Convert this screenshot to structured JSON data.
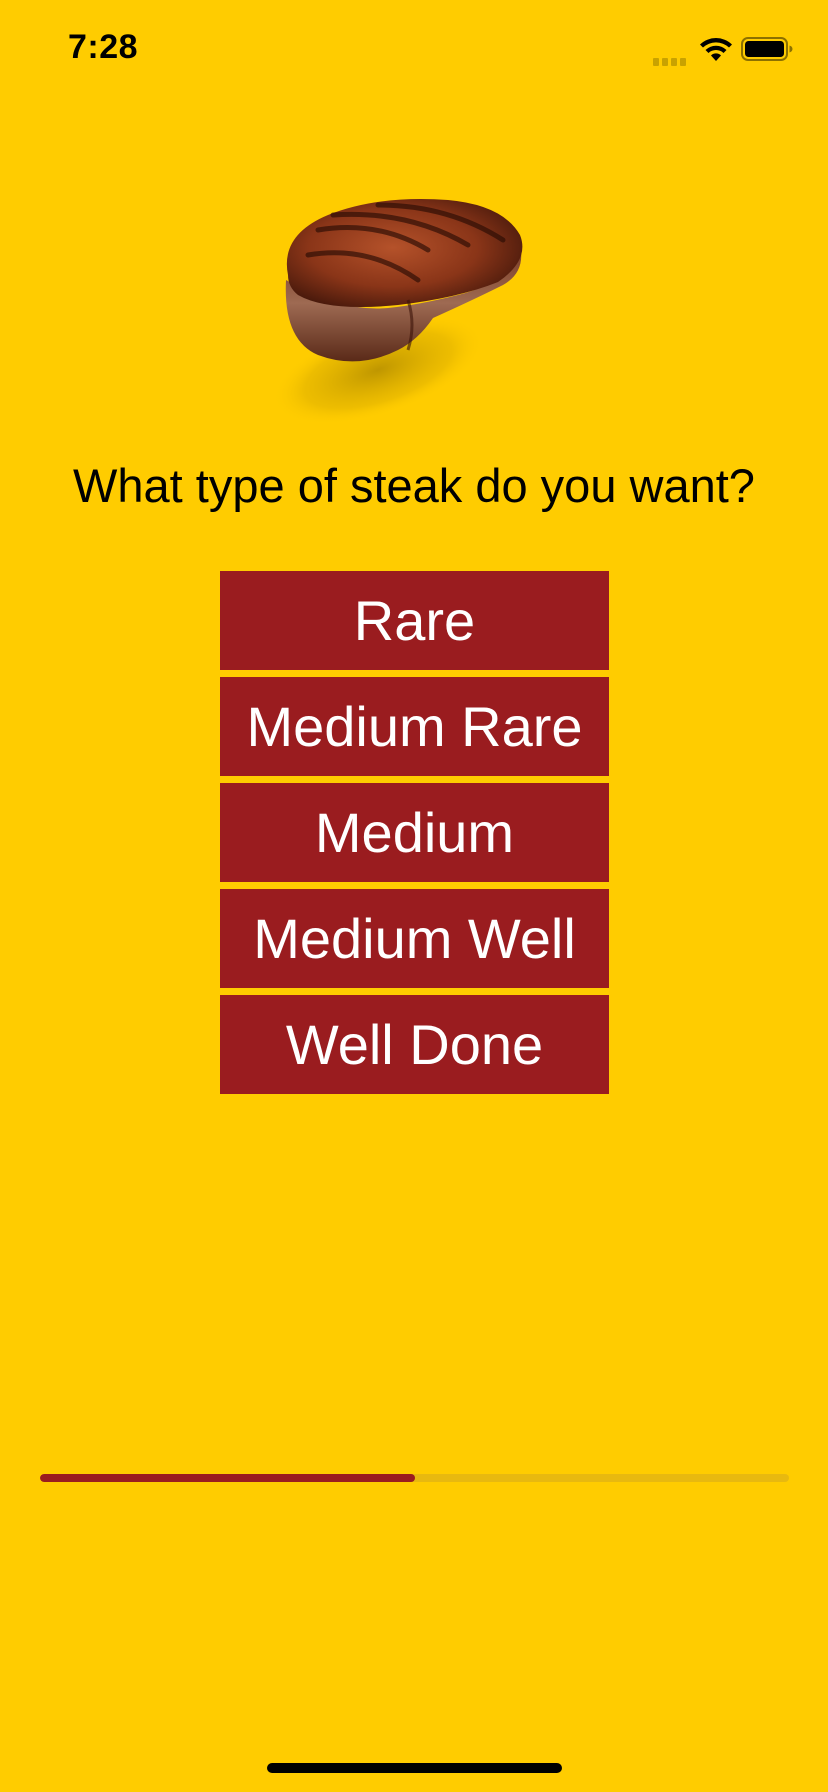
{
  "status_bar": {
    "time": "7:28",
    "icons": [
      "cellular-signal-icon",
      "wifi-icon",
      "battery-icon"
    ]
  },
  "image": {
    "subject": "grilled-steak"
  },
  "question": "What type of steak do you want?",
  "choices": [
    {
      "label": "Rare"
    },
    {
      "label": "Medium Rare"
    },
    {
      "label": "Medium"
    },
    {
      "label": "Medium Well"
    },
    {
      "label": "Well Done"
    }
  ],
  "progress": {
    "fraction": 0.5
  },
  "colors": {
    "background": "#FFCC00",
    "button": "#9A1C1F",
    "button_text": "#FFFFFF",
    "progress_fill": "#9A1C1F",
    "progress_track": "#E8B90F"
  }
}
